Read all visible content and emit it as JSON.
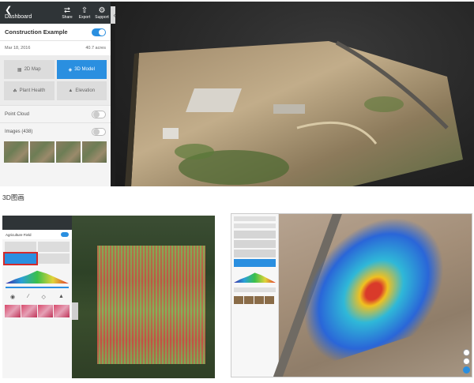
{
  "top": {
    "toolbar": {
      "back_label": "Dashboard",
      "share_label": "Share",
      "export_label": "Export",
      "support_label": "Support"
    },
    "project": {
      "title": "Construction Example",
      "visible": true
    },
    "meta": {
      "date": "Mar 18, 2016",
      "acres": "40.7 acres"
    },
    "modes": [
      {
        "label": "2D Map",
        "active": false
      },
      {
        "label": "3D Model",
        "active": true
      },
      {
        "label": "Plant Health",
        "active": false
      },
      {
        "label": "Elevation",
        "active": false
      }
    ],
    "options": [
      {
        "label": "Point Cloud",
        "on": false
      },
      {
        "label": "Images (438)",
        "on": false
      }
    ],
    "collapse_icon": "chevron-left-icon"
  },
  "caption": "3D图画",
  "bottom_left": {
    "project_title": "Agriculture Field"
  },
  "bottom_right": {},
  "colors": {
    "accent": "#2a8fe0",
    "toolbar": "#2f3437",
    "highlight": "#d42a2a"
  }
}
